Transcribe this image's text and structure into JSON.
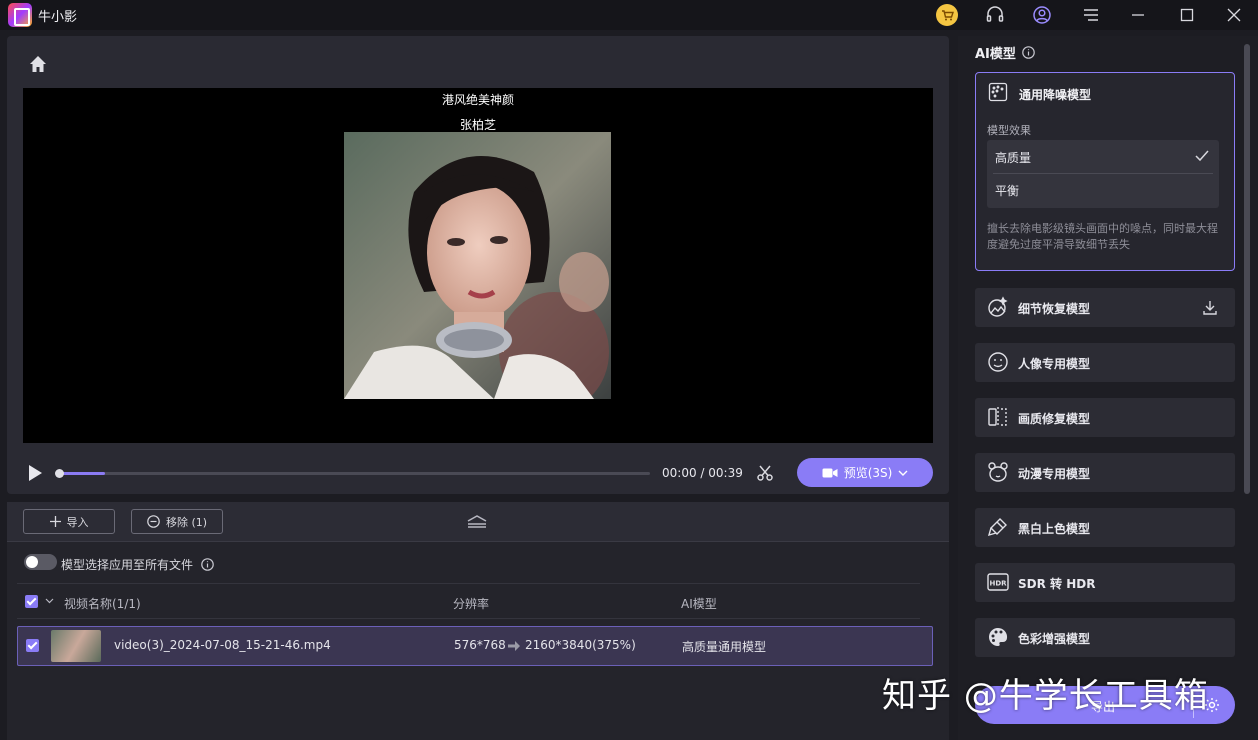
{
  "app": {
    "title": "牛小影"
  },
  "video": {
    "caption_line1": "港风绝美神颜",
    "caption_line2": "张柏芝",
    "progress": 0.08
  },
  "player": {
    "time": "00:00 / 00:39",
    "preview_label": "预览(3S)"
  },
  "file_toolbar": {
    "import_label": "导入",
    "remove_label": "移除 (1)"
  },
  "apply_all": {
    "label": "模型选择应用至所有文件",
    "enabled": false
  },
  "table": {
    "headers": {
      "name": "视频名称(1/1)",
      "resolution": "分辨率",
      "model": "AI模型"
    },
    "rows": [
      {
        "name": "video(3)_2024-07-08_15-21-46.mp4",
        "res_from": "576*768",
        "res_to": "2160*3840(375%)",
        "model": "高质量通用模型"
      }
    ]
  },
  "sidebar": {
    "title": "AI模型",
    "active_model": {
      "title": "通用降噪模型",
      "effect_label": "模型效果",
      "options": [
        "高质量",
        "平衡"
      ],
      "selected": "高质量",
      "description": "擅长去除电影级镜头画面中的噪点，同时最大程度避免过度平滑导致细节丢失"
    },
    "models": [
      {
        "label": "细节恢复模型",
        "icon": "landscape-icon"
      },
      {
        "label": "人像专用模型",
        "icon": "face-icon"
      },
      {
        "label": "画质修复模型",
        "icon": "compare-icon"
      },
      {
        "label": "动漫专用模型",
        "icon": "bear-icon"
      },
      {
        "label": "黑白上色模型",
        "icon": "brush-icon"
      },
      {
        "label": "SDR 转 HDR",
        "icon": "hdr-icon"
      },
      {
        "label": "色彩增强模型",
        "icon": "palette-icon"
      }
    ],
    "export_label": "导出"
  },
  "watermark": "知乎 @牛学长工具箱",
  "colors": {
    "accent": "#8a7cf6",
    "panel": "#2a2a33",
    "background": "#1c1c22"
  }
}
